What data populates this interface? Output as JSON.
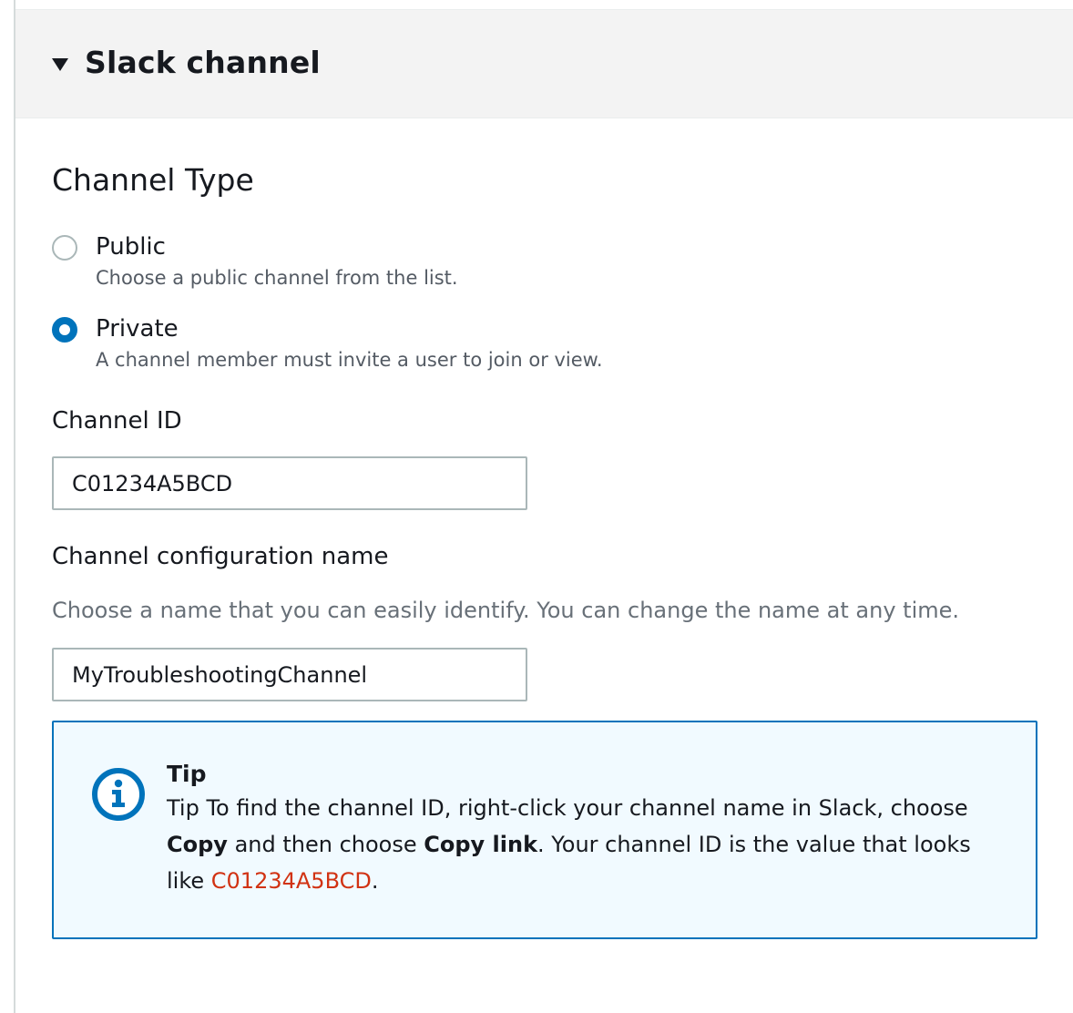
{
  "header": {
    "title": "Slack channel"
  },
  "channel_type": {
    "title": "Channel Type",
    "options": [
      {
        "label": "Public",
        "description": "Choose a public channel from the list.",
        "selected": false
      },
      {
        "label": "Private",
        "description": "A channel member must invite a user to join or view.",
        "selected": true
      }
    ]
  },
  "channel_id": {
    "label": "Channel ID",
    "value": "C01234A5BCD"
  },
  "config_name": {
    "label": "Channel configuration name",
    "description": "Choose a name that you can easily identify. You can change the name at any time.",
    "value": "MyTroubleshootingChannel"
  },
  "tip": {
    "title": "Tip",
    "text_1": "Tip To find the channel ID, right-click your channel name in Slack, choose ",
    "bold_1": "Copy",
    "text_2": " and then choose ",
    "bold_2": "Copy link",
    "text_3": ". Your channel ID is the value that looks like ",
    "code": "C01234A5BCD",
    "text_4": "."
  },
  "colors": {
    "accent": "#0073bb",
    "code": "#d13212",
    "tip_background": "#f1faff",
    "header_background": "#f3f3f3"
  },
  "icons": {
    "caret": "caret-down-icon",
    "info": "info-icon"
  }
}
